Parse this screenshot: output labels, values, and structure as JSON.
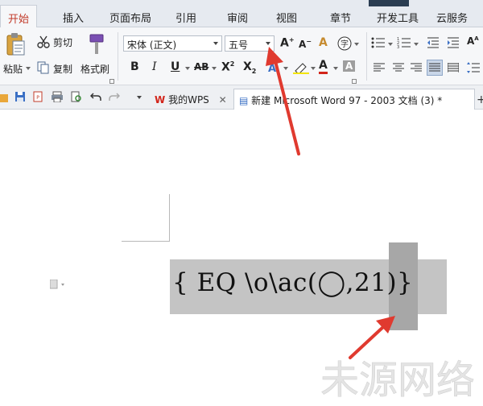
{
  "tabs": [
    "开始",
    "插入",
    "页面布局",
    "引用",
    "审阅",
    "视图",
    "章节",
    "开发工具",
    "云服务"
  ],
  "active_tab": "开始",
  "clipboard": {
    "paste": "粘贴",
    "cut": "剪切",
    "copy": "复制",
    "format_painter": "格式刷"
  },
  "font": {
    "name": "宋体 (正文)",
    "size": "五号"
  },
  "quick_access": {
    "tab_wps": "我的WPS",
    "tab_doc": "新建 Microsoft Word 97 - 2003 文档 (3) *"
  },
  "field_code": "{ EQ \\o\\ac(◯,21)}",
  "watermark": "未源网络",
  "colors": {
    "accent": "#c23b2a",
    "arrow": "#e03a2f",
    "field_bg": "#c4c4c4",
    "field_highlight": "#a7a7a7"
  }
}
